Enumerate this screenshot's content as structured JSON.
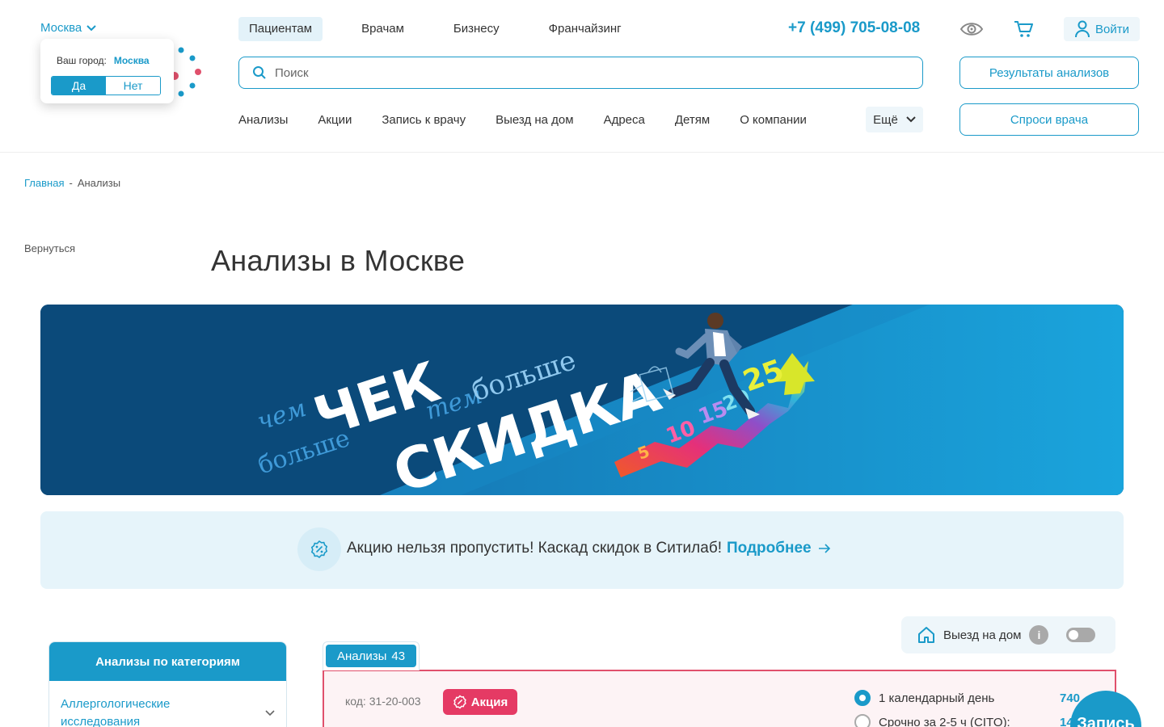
{
  "header": {
    "city": "Москва",
    "city_popup": {
      "question": "Ваш город:",
      "city": "Москва",
      "yes": "Да",
      "no": "Нет"
    },
    "nav": [
      "Пациентам",
      "Врачам",
      "Бизнесу",
      "Франчайзинг"
    ],
    "phone": "+7 (499) 705-08-08",
    "login": "Войти",
    "search_placeholder": "Поиск",
    "results_button": "Результаты анализов",
    "ask_button": "Спроси врача",
    "subnav": [
      "Анализы",
      "Акции",
      "Запись к врачу",
      "Выезд на дом",
      "Адреса",
      "Детям",
      "О компании"
    ],
    "more": "Ещё"
  },
  "breadcrumb": {
    "home": "Главная",
    "sep": "-",
    "current": "Анализы"
  },
  "back": "Вернуться",
  "title": "Анализы в Москве",
  "banner": {
    "line1": "чем",
    "line2": "больше",
    "word1": "ЧЕК",
    "line3": "тем",
    "line4": "больше",
    "word2": "СКИДКА",
    "steps": [
      "5",
      "10",
      "15",
      "20",
      "25"
    ]
  },
  "promo": {
    "text": "Акцию нельзя пропустить! Каскад скидок в Ситилаб!",
    "link": "Подробнее"
  },
  "filter": {
    "home_visit": "Выезд на дом",
    "info": "i"
  },
  "categories": {
    "title": "Анализы по категориям",
    "first_item": "Аллергологические исследования"
  },
  "tab": {
    "label": "Анализы",
    "count": "43"
  },
  "card": {
    "code": "код: 31-20-003",
    "badge": "Акция",
    "options": [
      {
        "label": "1 календарный день",
        "price": "740"
      },
      {
        "label": "Срочно за 2-5 ч (CITO):",
        "price": "148"
      }
    ]
  },
  "fab": "Запись",
  "colors": {
    "brand": "#1a9ac9",
    "sale": "#e53a64",
    "banner_dark": "#0b4a7a"
  }
}
